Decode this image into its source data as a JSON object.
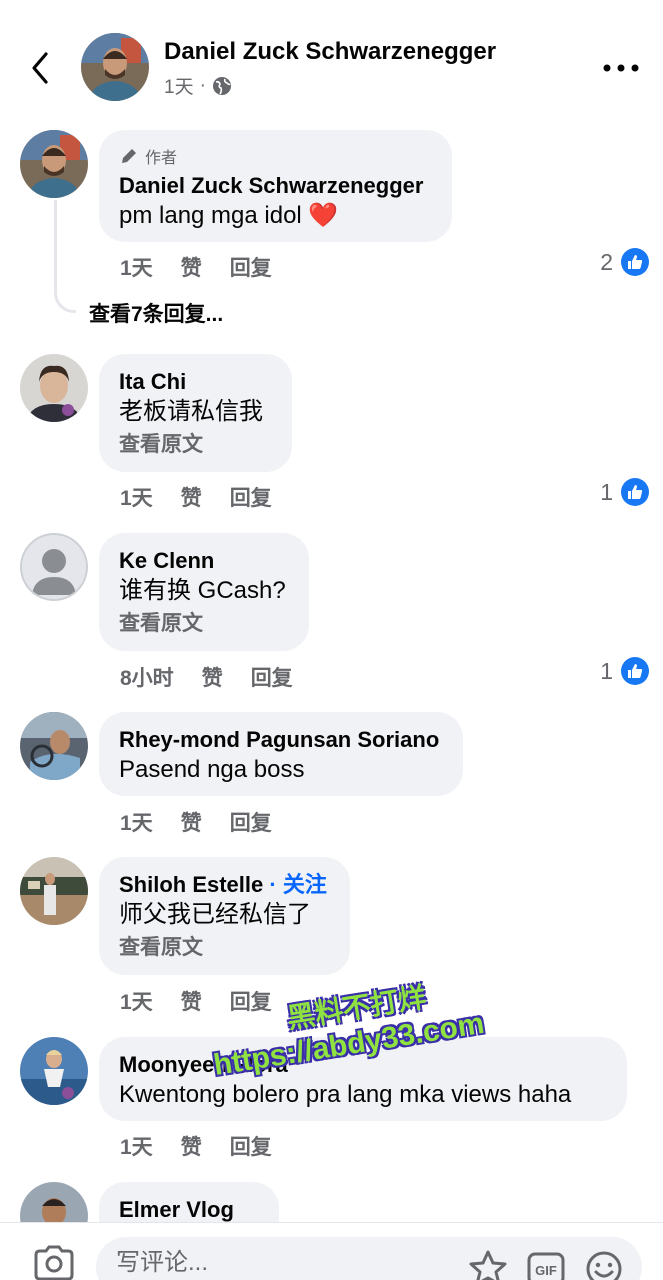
{
  "header": {
    "name": "Daniel Zuck Schwarzenegger",
    "time": "1天",
    "separator": "·"
  },
  "comments": [
    {
      "author_tag": "作者",
      "name": "Daniel Zuck Schwarzenegger",
      "text": "pm lang mga idol ❤️",
      "time": "1天",
      "like": "赞",
      "reply": "回复",
      "reactions": "2",
      "view_replies": "查看7条回复..."
    },
    {
      "name": "Ita Chi",
      "text": "老板请私信我",
      "translate": "查看原文",
      "time": "1天",
      "like": "赞",
      "reply": "回复",
      "reactions": "1"
    },
    {
      "name": "Ke Clenn",
      "text": "谁有换 GCash?",
      "translate": "查看原文",
      "time": "8小时",
      "like": "赞",
      "reply": "回复",
      "reactions": "1"
    },
    {
      "name": "Rhey-mond Pagunsan Soriano",
      "text": "Pasend nga boss",
      "time": "1天",
      "like": "赞",
      "reply": "回复"
    },
    {
      "name": "Shiloh Estelle",
      "follow": "· 关注",
      "text": "师父我已经私信了",
      "translate": "查看原文",
      "time": "1天",
      "like": "赞",
      "reply": "回复"
    },
    {
      "name": "Moonyeen Flora",
      "text": "Kwentong bolero pra lang mka views haha",
      "time": "1天",
      "like": "赞",
      "reply": "回复"
    },
    {
      "name": "Elmer Vlog"
    }
  ],
  "watermark": {
    "line1": "黑料不打烊",
    "line2": "https://abdy33.com"
  },
  "composer": {
    "placeholder": "写评论..."
  },
  "colors": {
    "accent": "#1877f2",
    "bubble": "#f0f2f5",
    "secondary_text": "#65676b"
  },
  "icons": [
    "back-arrow-icon",
    "globe-icon",
    "more-icon",
    "pencil-icon",
    "like-icon",
    "camera-icon",
    "sticker-icon",
    "gif-icon",
    "emoji-icon"
  ]
}
